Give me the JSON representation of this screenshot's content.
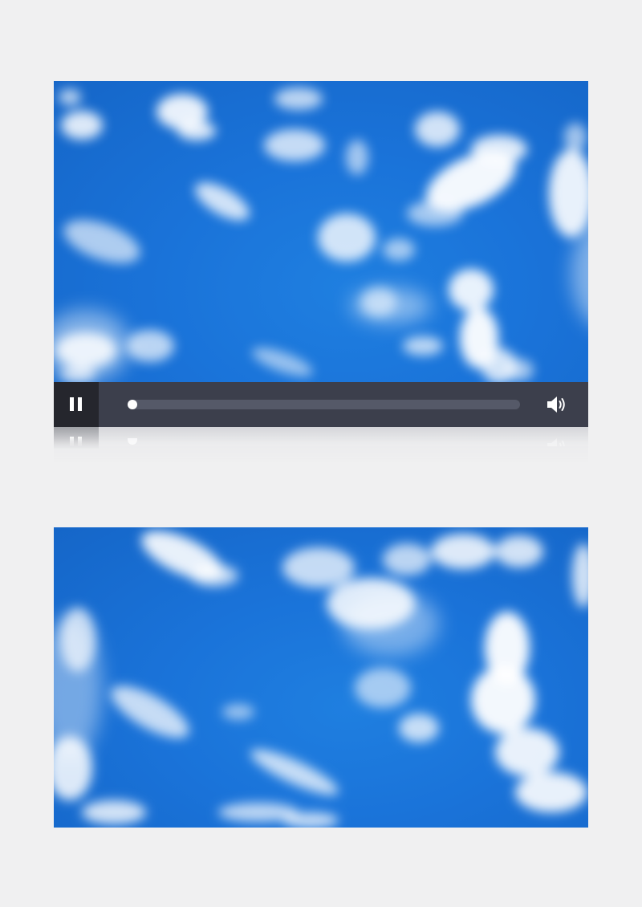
{
  "players": [
    {
      "controls": {
        "pause_icon": "pause-icon",
        "volume_icon": "speaker-volume-icon",
        "progress": 0.0
      }
    }
  ],
  "colors": {
    "page_background": "#f0f0f1",
    "sky_blue": "#1a73d9",
    "control_bar": "#3c3f4c",
    "pause_button_background": "#25262d",
    "progress_track": "#555968",
    "knob": "#ffffff"
  }
}
